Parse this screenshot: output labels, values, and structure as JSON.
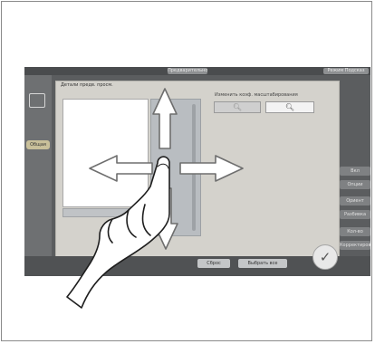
{
  "topbar": {
    "center_button": "Предварительно",
    "right_button": "Режим Подсказ"
  },
  "dialog": {
    "title": "Детали предв. просм.",
    "zoom_label": "Изменить коэф. масштабирования",
    "zoom_out_icon": "zoom-out-icon",
    "zoom_in_icon": "zoom-in-icon"
  },
  "left_panel": {
    "button": "Общая"
  },
  "right_panel": {
    "buttons": [
      "Вкл",
      "Опции",
      "Ориент",
      "Разбивка",
      "Кол-во",
      "Корректиров"
    ]
  },
  "bottom": {
    "cancel": "Сброс",
    "select_all": "Выбрать все"
  },
  "gesture": {
    "type": "drag",
    "directions": [
      "up",
      "down",
      "left",
      "right"
    ]
  },
  "ok_icon": "check-icon"
}
